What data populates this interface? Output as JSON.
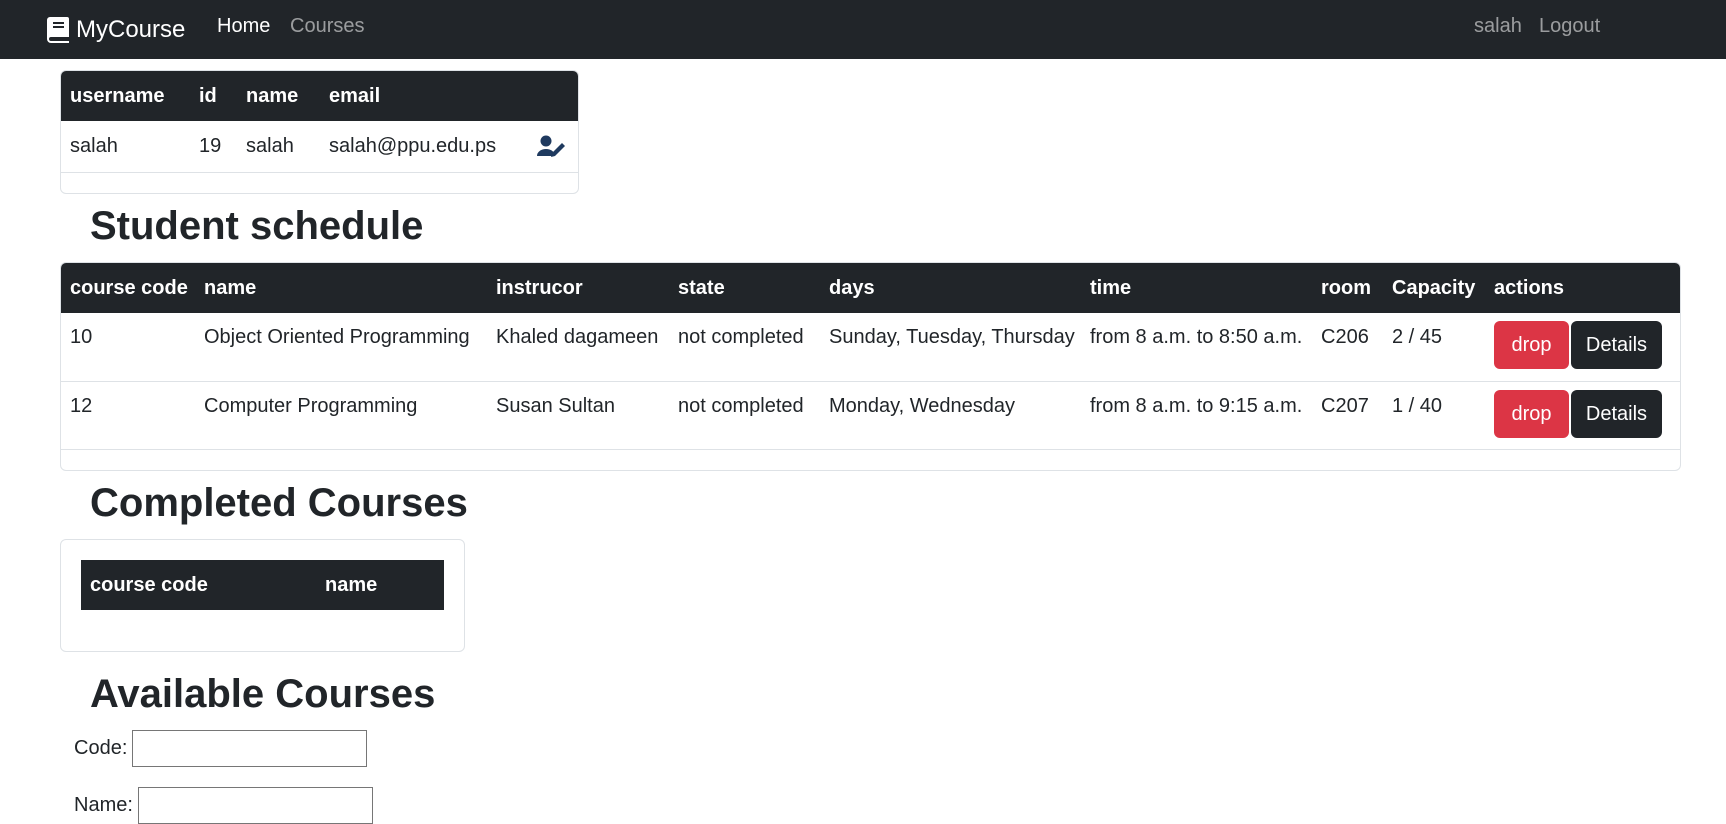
{
  "navbar": {
    "brand": "MyCourse",
    "links": {
      "home": "Home",
      "courses": "Courses"
    },
    "user": "salah",
    "logout": "Logout"
  },
  "user_table": {
    "headers": [
      "username",
      "id",
      "name",
      "email"
    ],
    "row": {
      "username": "salah",
      "id": "19",
      "name": "salah",
      "email": "salah@ppu.edu.ps"
    }
  },
  "schedule": {
    "title": "Student schedule",
    "headers": [
      "course code",
      "name",
      "instrucor",
      "state",
      "days",
      "time",
      "room",
      "Capacity",
      "actions"
    ],
    "rows": [
      {
        "code": "10",
        "name": "Object Oriented Programming",
        "instructor": "Khaled dagameen",
        "state": "not completed",
        "days": "Sunday, Tuesday, Thursday",
        "time": "from 8 a.m. to 8:50 a.m.",
        "room": "C206",
        "capacity": "2 / 45",
        "drop": "drop",
        "details": "Details"
      },
      {
        "code": "12",
        "name": "Computer Programming",
        "instructor": "Susan Sultan",
        "state": "not completed",
        "days": "Monday, Wednesday",
        "time": "from 8 a.m. to 9:15 a.m.",
        "room": "C207",
        "capacity": "1 / 40",
        "drop": "drop",
        "details": "Details"
      }
    ]
  },
  "completed": {
    "title": "Completed Courses",
    "headers": [
      "course code",
      "name"
    ]
  },
  "available": {
    "title": "Available Courses",
    "code_label": "Code:",
    "name_label": "Name:",
    "code_value": "",
    "name_value": ""
  },
  "colors": {
    "navbar": "#212529",
    "danger": "#dc3545",
    "dark": "#212529",
    "edit_icon": "#1f3a5f"
  },
  "icons": {
    "brand": "book-icon",
    "edit": "user-edit-icon"
  }
}
